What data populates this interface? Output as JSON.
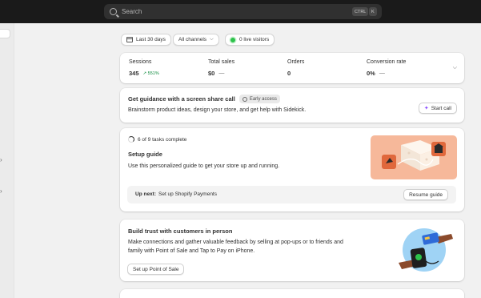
{
  "search": {
    "placeholder": "Search",
    "shortcut_keys": [
      "CTRL",
      "K"
    ]
  },
  "filters": {
    "date_range": "Last 30 days",
    "channels": "All channels",
    "live_visitors": "0 live visitors"
  },
  "metrics": [
    {
      "label": "Sessions",
      "value": "345",
      "delta": "551%"
    },
    {
      "label": "Total sales",
      "value": "$0",
      "delta": "—"
    },
    {
      "label": "Orders",
      "value": "0",
      "delta": ""
    },
    {
      "label": "Conversion rate",
      "value": "0%",
      "delta": "—"
    }
  ],
  "guidance": {
    "title": "Get guidance with a screen share call",
    "badge": "Early access",
    "body": "Brainstorm product ideas, design your store, and get help with Sidekick.",
    "button": "Start call"
  },
  "setup": {
    "progress": "6 of 9 tasks complete",
    "progress_fraction": 0.667,
    "title": "Setup guide",
    "body": "Use this personalized guide to get your store up and running.",
    "up_next_label": "Up next:",
    "up_next_text": "Set up Shopify Payments",
    "button": "Resume guide"
  },
  "pos": {
    "title": "Build trust with customers in person",
    "body_line1": "Make connections and gather valuable feedback by selling at pop-ups or to friends and",
    "body_line2": "family with Point of Sale and Tap to Pay on iPhone.",
    "button": "Set up Point of Sale"
  },
  "colors": {
    "topbar": "#1a1a1a",
    "background": "#f1f1f1",
    "live_dot": "#2dc24b",
    "positive_delta": "#0c8a3c",
    "illustration_peach": "#f6b89a",
    "illustration_blue": "#9fd3f5"
  }
}
